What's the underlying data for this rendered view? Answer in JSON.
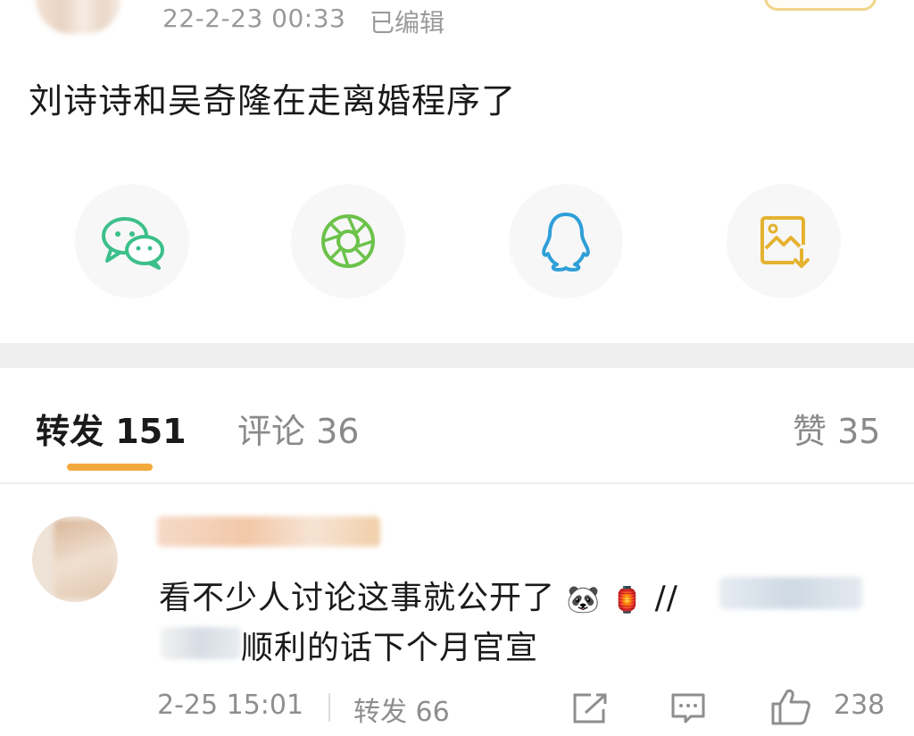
{
  "post": {
    "timestamp": "22-2-23 00:33",
    "edited_label": "已编辑",
    "text": "刘诗诗和吴奇隆在走离婚程序了"
  },
  "share": [
    {
      "name": "wechat",
      "icon": "wechat-icon",
      "color": "#3cbf8a"
    },
    {
      "name": "moments",
      "icon": "wechat-moments-icon",
      "color": "#6cc24a"
    },
    {
      "name": "qq",
      "icon": "qq-icon",
      "color": "#2f9fd8"
    },
    {
      "name": "save-image",
      "icon": "save-image-icon",
      "color": "#e5b230"
    }
  ],
  "tabs": {
    "repost_label": "转发",
    "repost_count": "151",
    "comment_label": "评论",
    "comment_count": "36",
    "like_label": "赞",
    "like_count": "35"
  },
  "comment": {
    "line1": "看不少人讨论这事就公开了",
    "slashes": "//",
    "line2": "顺利的话下个月官宣",
    "time": "2-25 15:01",
    "repost_label": "转发",
    "repost_count": "66",
    "like_count": "238"
  },
  "colors": {
    "accent": "#f2a93b",
    "muted": "#8e8e8e",
    "divider": "#efefef"
  }
}
